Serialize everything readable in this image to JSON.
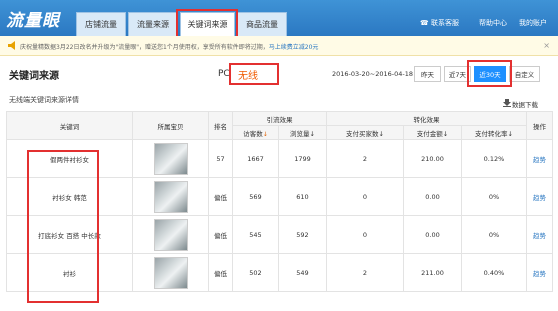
{
  "app": {
    "logo": "流量眼"
  },
  "tabs": [
    {
      "label": "店铺流量"
    },
    {
      "label": "流量来源"
    },
    {
      "label": "关键词来源"
    },
    {
      "label": "商品流量"
    }
  ],
  "top_links": {
    "contact": "联系客服",
    "help": "帮助中心",
    "account": "我的账户"
  },
  "notice": {
    "text": "庆祝量精数据3月22日改名并升级为\"流量眼\"，赠送您1个月使用权，享受所有软件即将过期，",
    "link": "马上续费立减20元"
  },
  "page": {
    "title": "关键词来源",
    "device_pc": "PC",
    "device_wireless": "无线",
    "date_range": "2016-03-20~2016-04-18",
    "subtitle": "无线端关键词来源详情",
    "download": "数据下载"
  },
  "date_buttons": [
    {
      "label": "昨天"
    },
    {
      "label": "近7天"
    },
    {
      "label": "近30天"
    },
    {
      "label": "自定义"
    }
  ],
  "table": {
    "group_headers": {
      "traffic": "引流效果",
      "conversion": "转化效果"
    },
    "headers": {
      "keyword": "关键词",
      "item": "所属宝贝",
      "rank": "排名",
      "visitors": "访客数",
      "pageviews": "浏览量",
      "buyers": "支付买家数",
      "amount": "支付金额",
      "cvr": "支付转化率",
      "action": "操作"
    },
    "sort_markers": {
      "active": "↓",
      "inactive": "↓"
    },
    "rows": [
      {
        "keyword": "假两件衬衫女",
        "rank": "57",
        "visitors": "1667",
        "pageviews": "1799",
        "buyers": "2",
        "amount": "210.00",
        "cvr": "0.12%",
        "action": "趋势"
      },
      {
        "keyword": "衬衫女 韩范",
        "rank": "偏低",
        "visitors": "569",
        "pageviews": "610",
        "buyers": "0",
        "amount": "0.00",
        "cvr": "0%",
        "action": "趋势"
      },
      {
        "keyword": "打底衫女 百搭 中长款",
        "rank": "偏低",
        "visitors": "545",
        "pageviews": "592",
        "buyers": "0",
        "amount": "0.00",
        "cvr": "0%",
        "action": "趋势"
      },
      {
        "keyword": "衬衫",
        "rank": "偏低",
        "visitors": "502",
        "pageviews": "549",
        "buyers": "2",
        "amount": "211.00",
        "cvr": "0.40%",
        "action": "趋势"
      }
    ]
  },
  "colors": {
    "header_blue": "#2b78c2",
    "highlight_red": "#e33030",
    "active_button": "#1e90ff",
    "accent_orange": "#f05a00"
  }
}
